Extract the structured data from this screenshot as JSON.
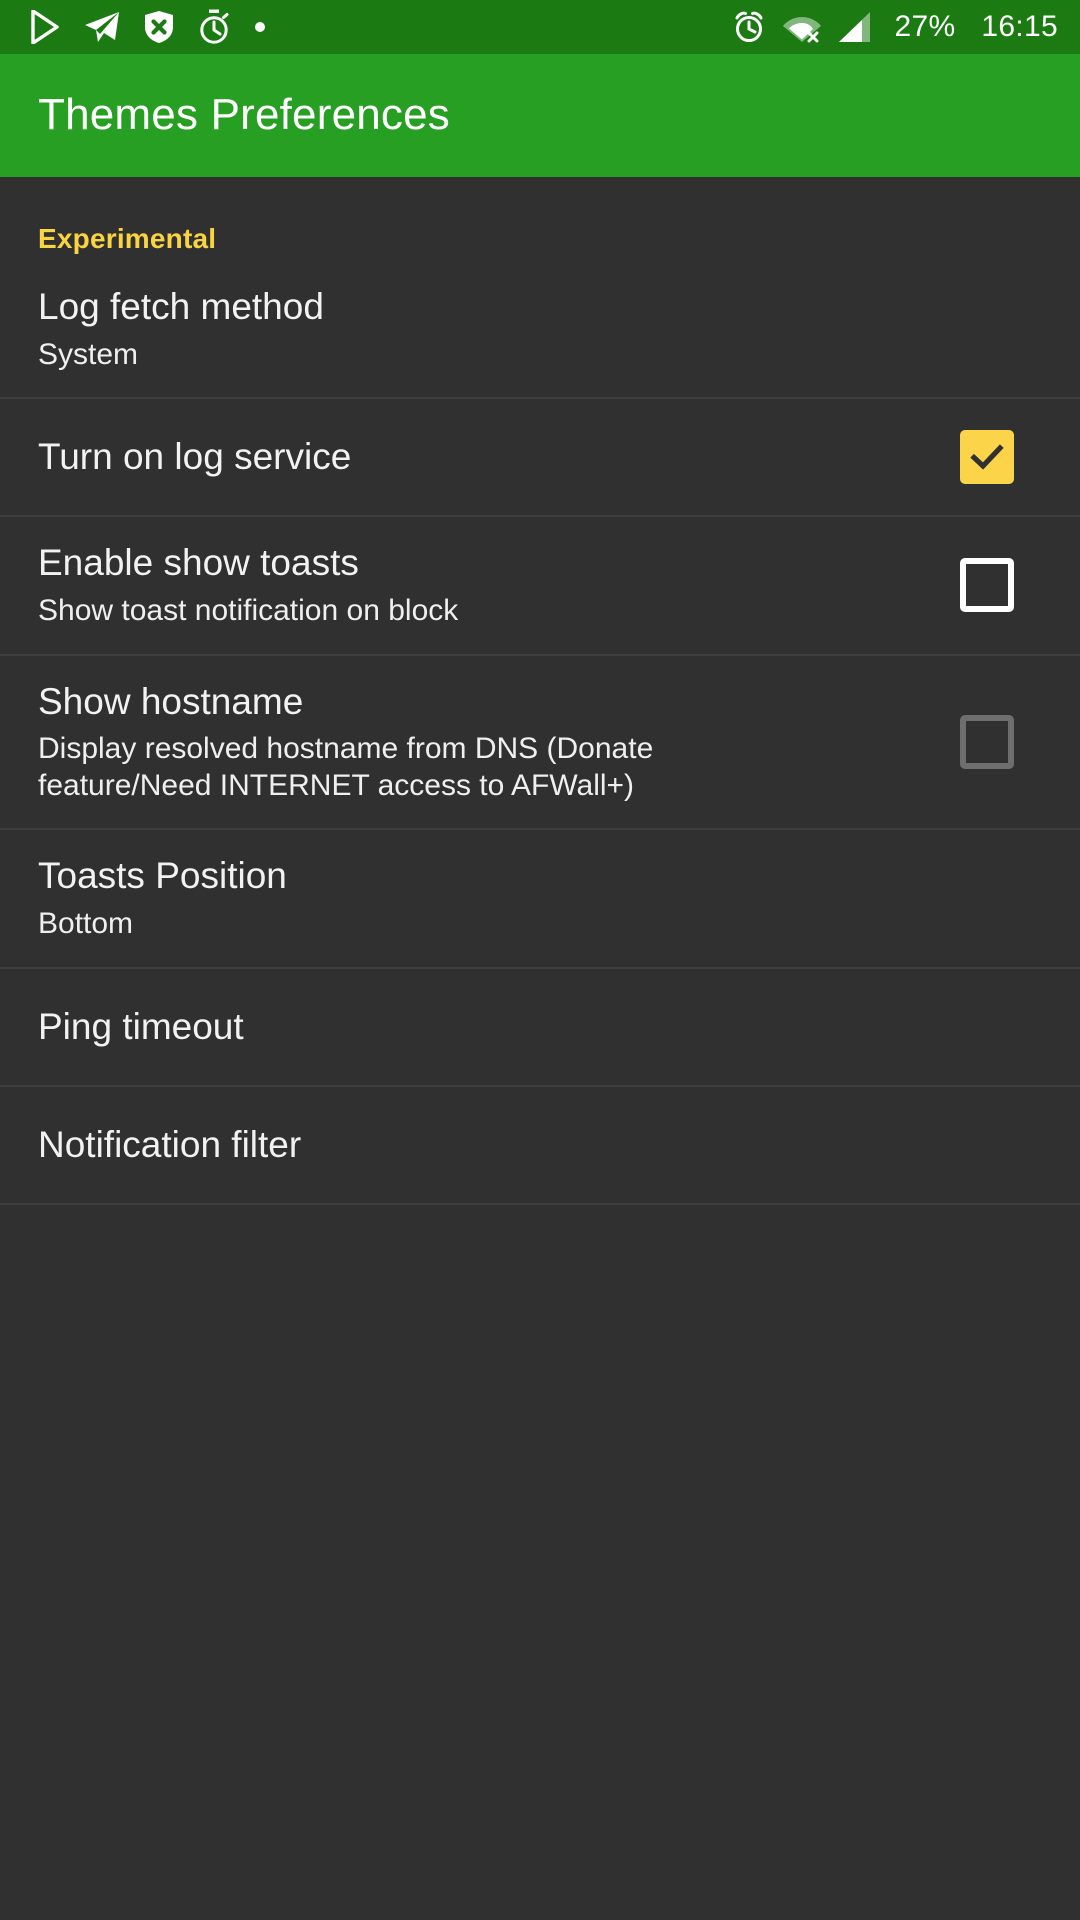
{
  "status_bar": {
    "background_color": "#1b7a12",
    "left_icons": [
      {
        "name": "play-store-icon",
        "glyph": "play-triangle"
      },
      {
        "name": "telegram-icon",
        "glyph": "paper-plane"
      },
      {
        "name": "shield-block-icon",
        "glyph": "shield-x"
      },
      {
        "name": "stopwatch-icon",
        "glyph": "stopwatch"
      },
      {
        "name": "more-notifications-dot-icon",
        "glyph": "dot"
      }
    ],
    "right_icons": [
      {
        "name": "alarm-clock-icon",
        "glyph": "alarm"
      },
      {
        "name": "wifi-disconnected-icon",
        "glyph": "wifi-x"
      },
      {
        "name": "cellular-signal-icon",
        "glyph": "signal-bars"
      }
    ],
    "battery_percent": "27%",
    "clock": "16:15"
  },
  "action_bar": {
    "title": "Themes Preferences",
    "background_color": "#279f23"
  },
  "screen": {
    "background_color": "#303030",
    "accent_color": "#f9d440",
    "divider_color": "#3d3d3d"
  },
  "preferences": {
    "section_header": "Experimental",
    "items": [
      {
        "key": "log-fetch-method",
        "title": "Log fetch method",
        "summary": "System",
        "widget": "none"
      },
      {
        "key": "turn-on-log-service",
        "title": "Turn on log service",
        "summary": "",
        "widget": "checkbox",
        "checked": true,
        "enabled": true
      },
      {
        "key": "enable-show-toasts",
        "title": "Enable show toasts",
        "summary": "Show toast notification on block",
        "widget": "checkbox",
        "checked": false,
        "enabled": true
      },
      {
        "key": "show-hostname",
        "title": "Show hostname",
        "summary": "Display resolved hostname from DNS (Donate feature/Need INTERNET access to AFWall+)",
        "widget": "checkbox",
        "checked": false,
        "enabled": false
      },
      {
        "key": "toasts-position",
        "title": "Toasts Position",
        "summary": "Bottom",
        "widget": "none"
      },
      {
        "key": "ping-timeout",
        "title": "Ping timeout",
        "summary": "",
        "widget": "none"
      },
      {
        "key": "notification-filter",
        "title": "Notification filter",
        "summary": "",
        "widget": "none"
      }
    ]
  }
}
